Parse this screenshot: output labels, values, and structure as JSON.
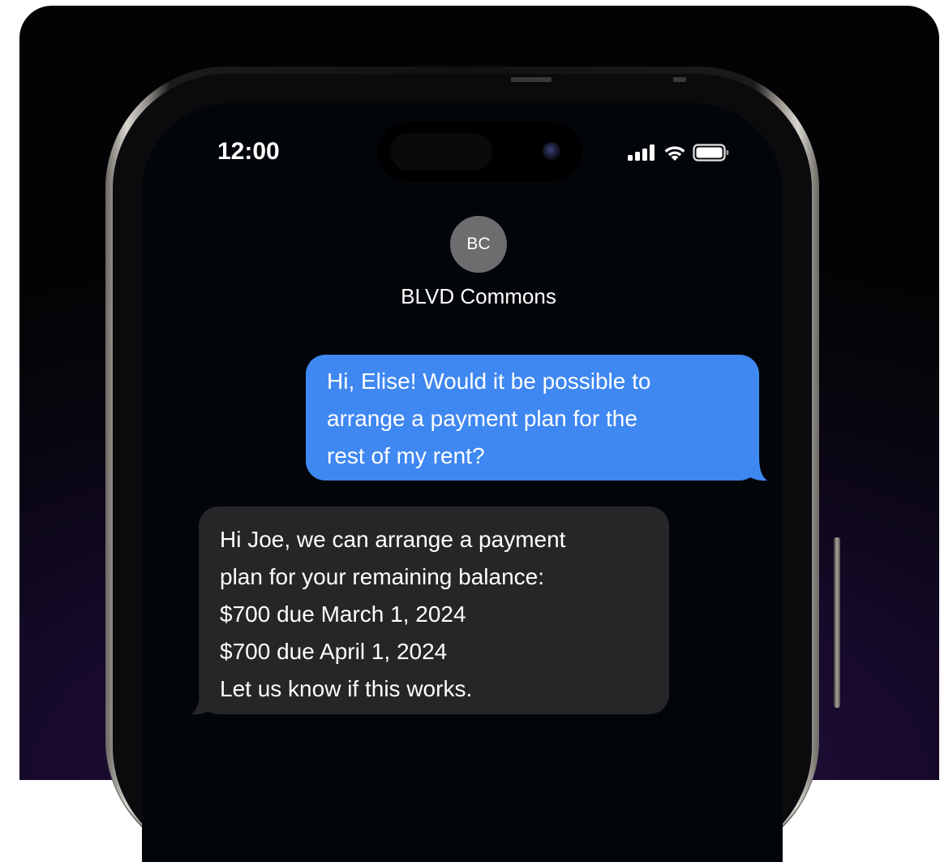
{
  "status_bar": {
    "time": "12:00",
    "icons": [
      "cellular-signal-icon",
      "wifi-icon",
      "battery-icon"
    ]
  },
  "contact": {
    "initials": "BC",
    "name": "BLVD Commons"
  },
  "messages": [
    {
      "direction": "outgoing",
      "lines": [
        "Hi, Elise! Would it be possible to",
        "arrange a payment plan for the",
        "rest of my rent?"
      ]
    },
    {
      "direction": "incoming",
      "lines": [
        "Hi Joe, we can arrange a payment",
        "plan for your remaining balance:",
        "$700 due March 1, 2024",
        "$700 due April 1, 2024",
        "Let us know if this works."
      ]
    }
  ],
  "colors": {
    "outgoing_bubble": "#3f87f1",
    "incoming_bubble": "#262628",
    "avatar": "#6d6d70",
    "screen": "#020509"
  }
}
